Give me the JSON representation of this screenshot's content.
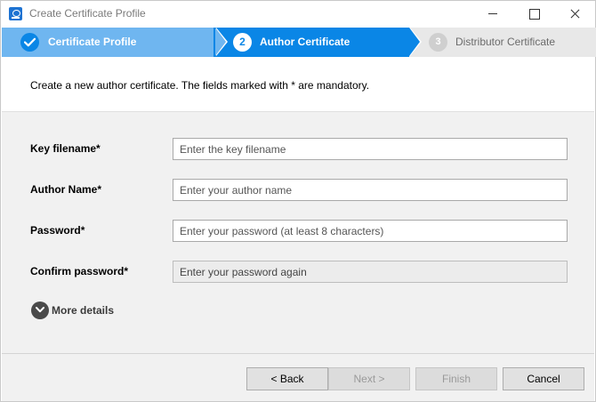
{
  "window": {
    "title": "Create Certificate Profile"
  },
  "steps": [
    {
      "number": "",
      "label": "Certificate Profile",
      "state": "completed"
    },
    {
      "number": "2",
      "label": "Author Certificate",
      "state": "active"
    },
    {
      "number": "3",
      "label": "Distributor Certificate",
      "state": "pending"
    }
  ],
  "instruction": "Create a new author certificate. The fields marked with * are mandatory.",
  "form": {
    "key_filename": {
      "label": "Key filename*",
      "placeholder": "Enter the key filename",
      "value": ""
    },
    "author_name": {
      "label": "Author Name*",
      "placeholder": "Enter your author name",
      "value": ""
    },
    "password": {
      "label": "Password*",
      "placeholder": "Enter your password (at least 8 characters)",
      "value": ""
    },
    "confirm_password": {
      "label": "Confirm password*",
      "placeholder": "Enter your password again",
      "value": ""
    },
    "more_details": "More details"
  },
  "footer": {
    "back": "< Back",
    "next": "Next >",
    "finish": "Finish",
    "cancel": "Cancel"
  },
  "colors": {
    "step_completed": "#6fb6f0",
    "step_active": "#0a86e6",
    "step_pending": "#e8e8e8",
    "panel_bg": "#f1f1f1"
  },
  "icons": {
    "app": "certificate-app-icon",
    "step_completed": "checkmark-icon",
    "more_details": "chevron-down-icon"
  }
}
